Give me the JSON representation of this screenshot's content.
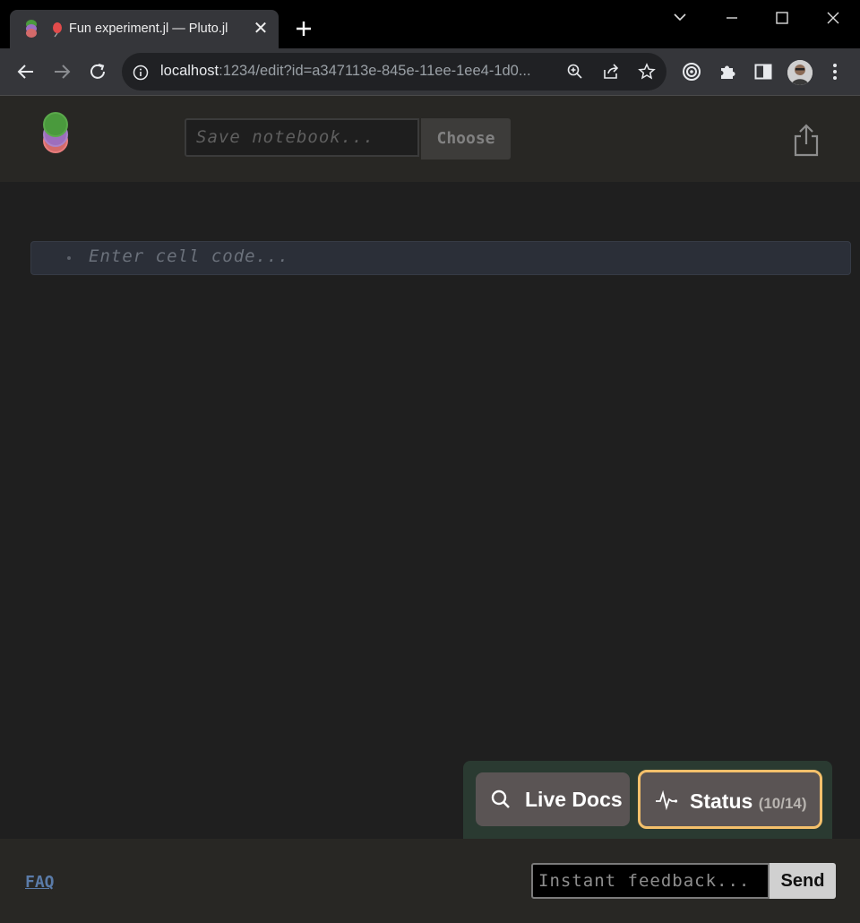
{
  "browser": {
    "tab_title": "Fun experiment.jl — Pluto.jl",
    "url_host": "localhost",
    "url_rest": ":1234/edit?id=a347113e-845e-11ee-1ee4-1d0...",
    "icons": [
      "back-icon",
      "forward-icon",
      "reload-icon",
      "info-icon",
      "zoom-icon",
      "share-icon",
      "star-icon",
      "extension-icon",
      "puzzle-icon",
      "side-panel-icon",
      "profile-avatar",
      "menu-icon"
    ]
  },
  "pluto": {
    "save_placeholder": "Save notebook...",
    "choose_label": "Choose",
    "cell_placeholder": "Enter cell code...",
    "live_docs_label": "Live Docs",
    "status_label": "Status",
    "status_count": "(10/14)",
    "faq_label": "FAQ",
    "feedback_placeholder": "Instant feedback...",
    "send_label": "Send",
    "colors": {
      "logo_green": "#4a9a3d",
      "logo_purple": "#9b6fc2",
      "logo_red": "#d36a6a",
      "status_border": "#f4c06b",
      "helpbox_bg": "#2a3a31"
    }
  }
}
